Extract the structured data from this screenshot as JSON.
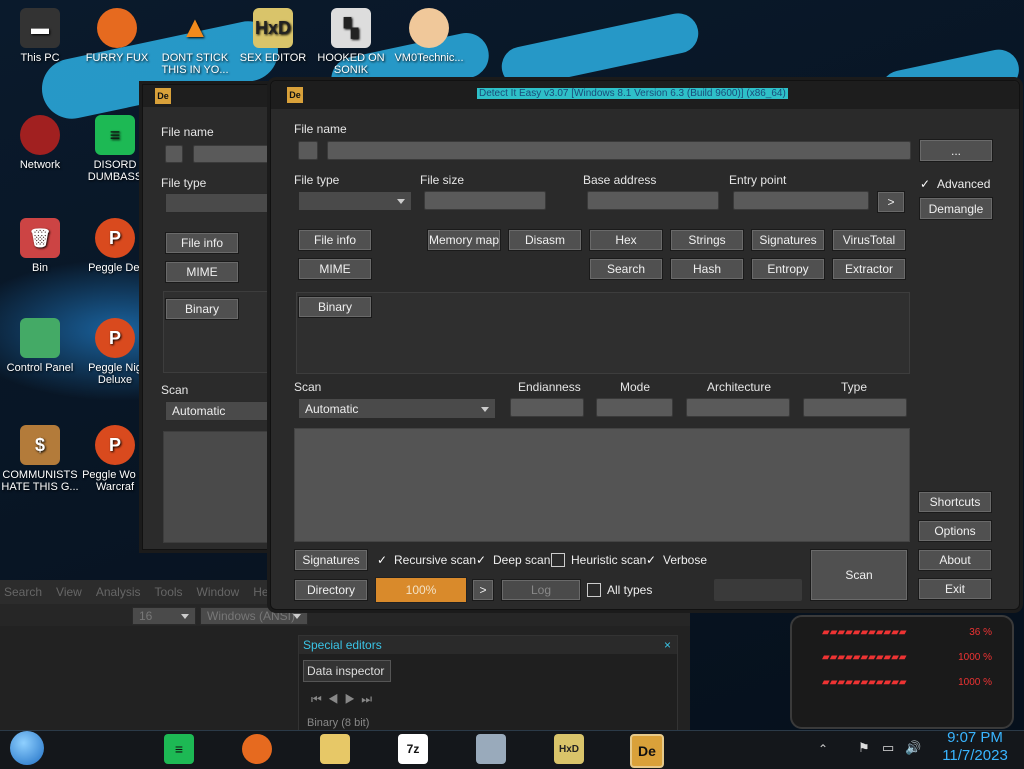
{
  "desktop": {
    "icons": [
      {
        "label": "This PC"
      },
      {
        "label": "FURRY FUX"
      },
      {
        "label": "DONT STICK THIS IN YO..."
      },
      {
        "label": "SEX EDITOR"
      },
      {
        "label": "HOOKED ON SONIK"
      },
      {
        "label": "VM0Technic..."
      },
      {
        "label": "Network"
      },
      {
        "label": "DISORD DUMBASS"
      },
      {
        "label": "Bin"
      },
      {
        "label": "Peggle Del"
      },
      {
        "label": "Control Panel"
      },
      {
        "label": "Peggle Nig Deluxe"
      },
      {
        "label": "COMMUNISTS HATE THIS G..."
      },
      {
        "label": "Peggle Wo of Warcraf"
      }
    ]
  },
  "back_window": {
    "file_name_label": "File name",
    "file_type_label": "File type",
    "file_info_button": "File info",
    "mime_button": "MIME",
    "binary_button": "Binary",
    "scan_label": "Scan",
    "scan_value": "Automatic"
  },
  "die": {
    "title": "Detect It Easy v3.07 [Windows 8.1 Version 6.3 (Build 9600)] (x86_64)",
    "file_name_label": "File name",
    "browse_button": "...",
    "file_type_label": "File type",
    "file_size_label": "File size",
    "base_address_label": "Base address",
    "entry_point_label": "Entry point",
    "entry_go_button": ">",
    "advanced_label": "Advanced",
    "demangle_button": "Demangle",
    "buttons": {
      "file_info": "File info",
      "memory_map": "Memory map",
      "disasm": "Disasm",
      "hex": "Hex",
      "strings": "Strings",
      "signatures": "Signatures",
      "virustotal": "VirusTotal",
      "mime": "MIME",
      "search": "Search",
      "hash": "Hash",
      "entropy": "Entropy",
      "extractor": "Extractor",
      "binary": "Binary"
    },
    "scan_label": "Scan",
    "scan_value": "Automatic",
    "endianness_label": "Endianness",
    "mode_label": "Mode",
    "architecture_label": "Architecture",
    "type_label": "Type",
    "side_buttons": {
      "shortcuts": "Shortcuts",
      "options": "Options",
      "about": "About",
      "exit": "Exit"
    },
    "bottom": {
      "signatures_button": "Signatures",
      "recursive_scan": "Recursive scan",
      "deep_scan": "Deep scan",
      "heuristic_scan": "Heuristic scan",
      "verbose": "Verbose",
      "directory_button": "Directory",
      "progress_text": "100%",
      "progress_value": 1.0,
      "next_button": ">",
      "log_button": "Log",
      "all_types": "All types",
      "scan_button": "Scan"
    }
  },
  "hex_editor": {
    "menu": [
      "Search",
      "View",
      "Analysis",
      "Tools",
      "Window",
      "He"
    ],
    "font_size": "16",
    "charset": "Windows (ANSI)",
    "special_editors_title": "Special editors",
    "close_glyph": "×",
    "tab": "Data inspector",
    "row_label": "Binary (8 bit)"
  },
  "gauges": [
    "36 %",
    "1000 %",
    "1000 %"
  ],
  "clock": {
    "time": "9:07 PM",
    "date": "11/7/2023"
  },
  "colors": {
    "accent": "#2ec0c8",
    "progress": "#d98a2b",
    "panel": "#2b2b2b"
  }
}
